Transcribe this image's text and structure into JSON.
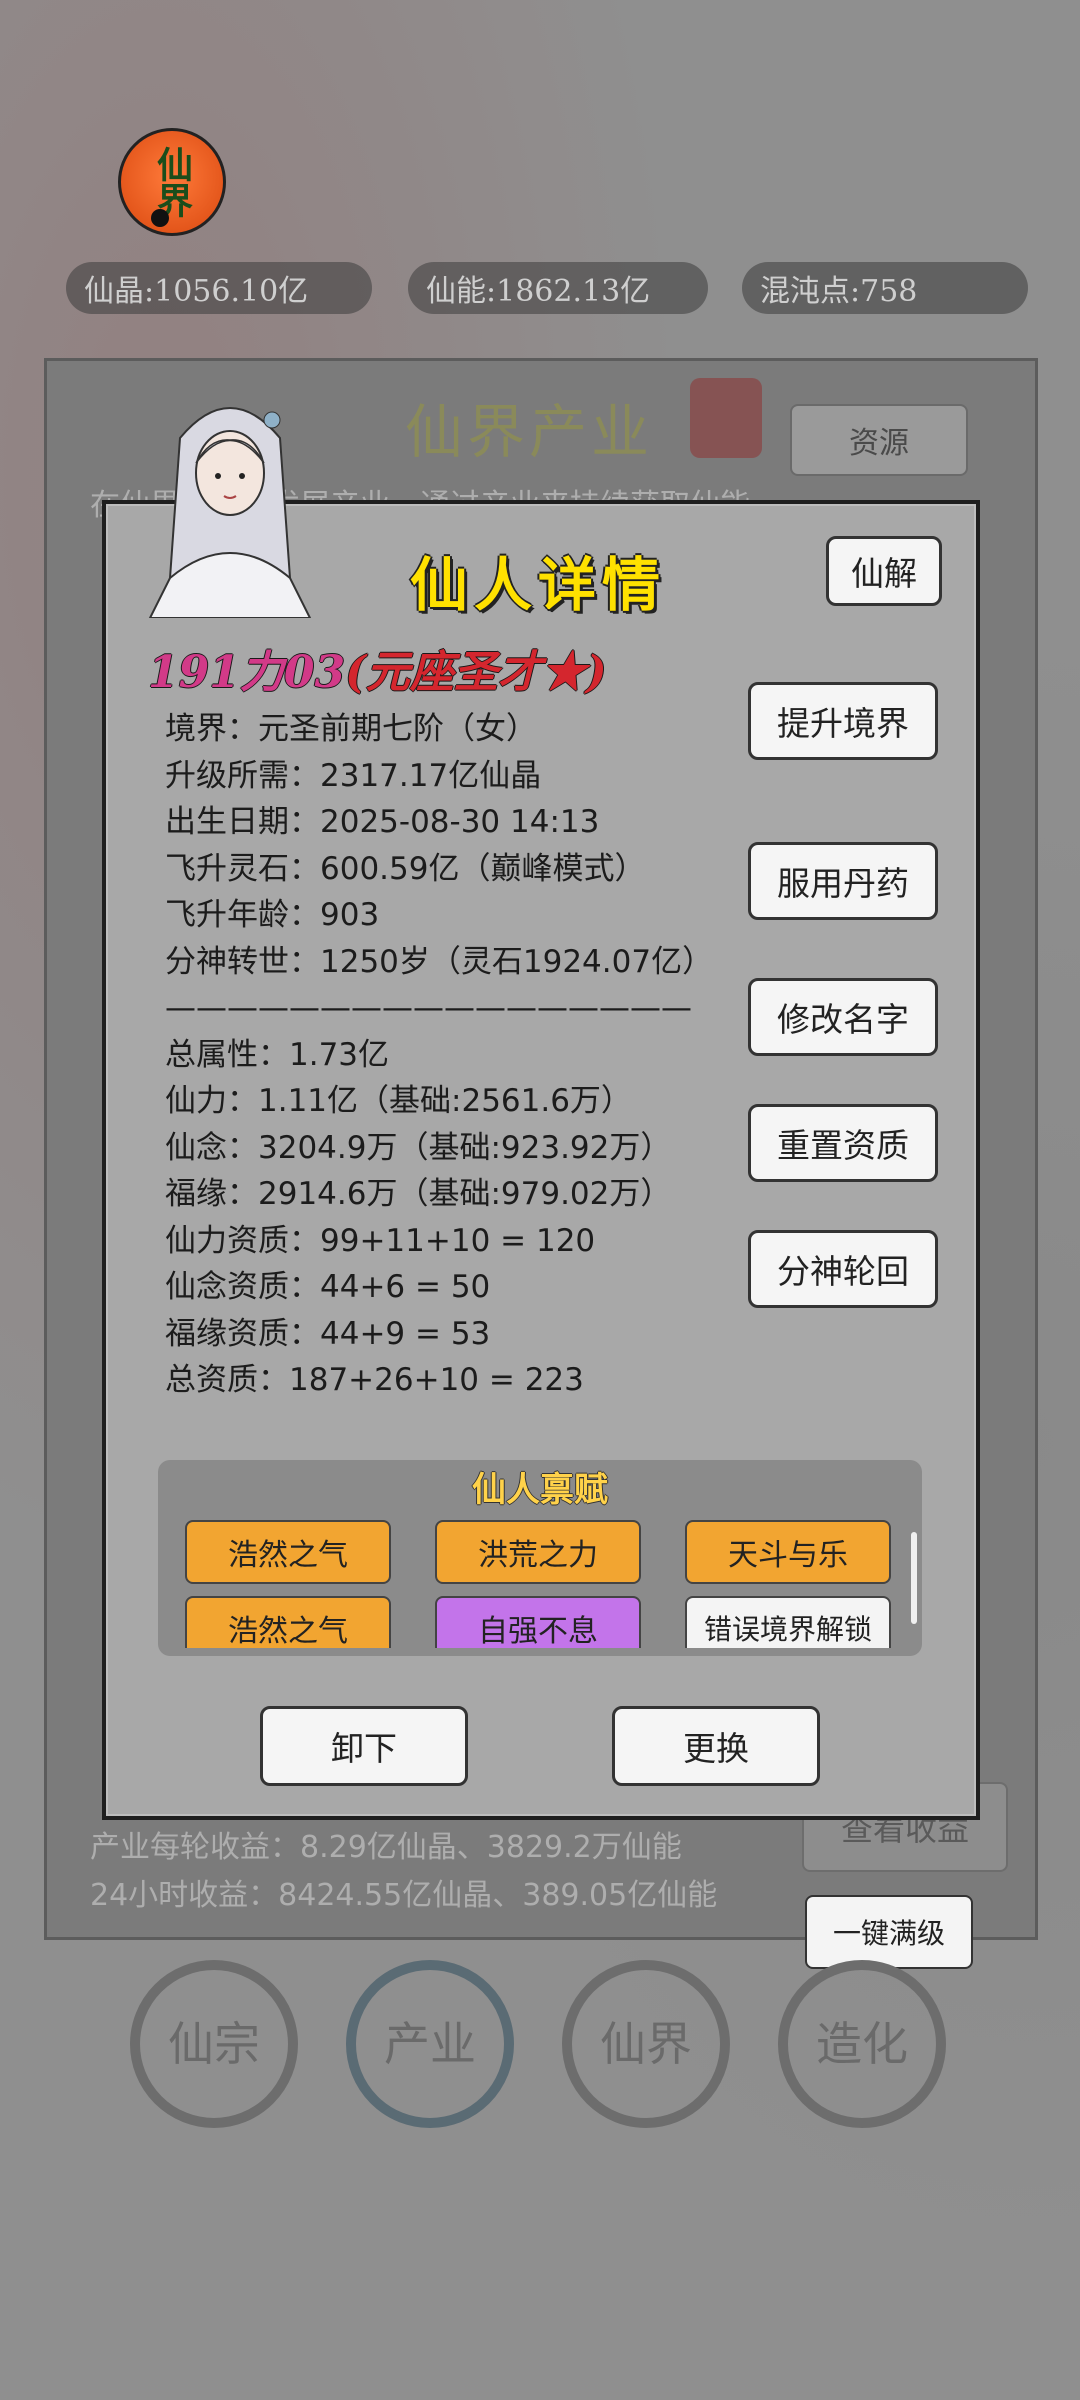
{
  "resources": {
    "logo_text": "仙界",
    "crystal": "仙晶:1056.10亿",
    "energy": "仙能:1862.13亿",
    "chaos": "混沌点:758"
  },
  "background": {
    "panel_title": "仙界产业",
    "resource_button": "资源",
    "hint_partial": "在仙界中可以发展产业，通过产业来持续获取仙能",
    "income_per_round": "产业每轮收益：8.29亿仙晶、3829.2万仙能",
    "income_24h": "24小时收益：8424.55亿仙晶、389.05亿仙能",
    "check_income_button": "查看收益",
    "one_key_max_button": "一键满级"
  },
  "nav": [
    "仙宗",
    "产业",
    "仙界",
    "造化"
  ],
  "dialog": {
    "title": "仙人详情",
    "xianjie_button": "仙解",
    "name": "191力03",
    "name_tag": "(元座圣才★)",
    "info_lines": [
      "境界：元圣前期七阶（女）",
      "升级所需：2317.17亿仙晶",
      "出生日期：2025-08-30 14:13",
      "飞升灵石：600.59亿（巅峰模式）",
      "飞升年龄：903",
      "分神转世：1250岁（灵石1924.07亿）",
      "—————————————————",
      "总属性：1.73亿",
      "仙力：1.11亿（基础:2561.6万）",
      "仙念：3204.9万（基础:923.92万）",
      "福缘：2914.6万（基础:979.02万）",
      "仙力资质：99+11+10 = 120",
      "仙念资质：44+6 = 50",
      "福缘资质：44+9 = 53",
      "总资质：187+26+10 = 223"
    ],
    "side_buttons": [
      "提升境界",
      "服用丹药",
      "修改名字",
      "重置资质",
      "分神轮回"
    ],
    "talent_title": "仙人禀赋",
    "talents": [
      {
        "label": "浩然之气",
        "color": "#f2a531"
      },
      {
        "label": "洪荒之力",
        "color": "#f2a531"
      },
      {
        "label": "天斗与乐",
        "color": "#f2a531"
      },
      {
        "label": "浩然之气",
        "color": "#f2a531"
      },
      {
        "label": "自强不息",
        "color": "#c374ea"
      },
      {
        "label": "错误境界解锁",
        "color": "#f4f4f4"
      }
    ],
    "unload_button": "卸下",
    "replace_button": "更换"
  }
}
